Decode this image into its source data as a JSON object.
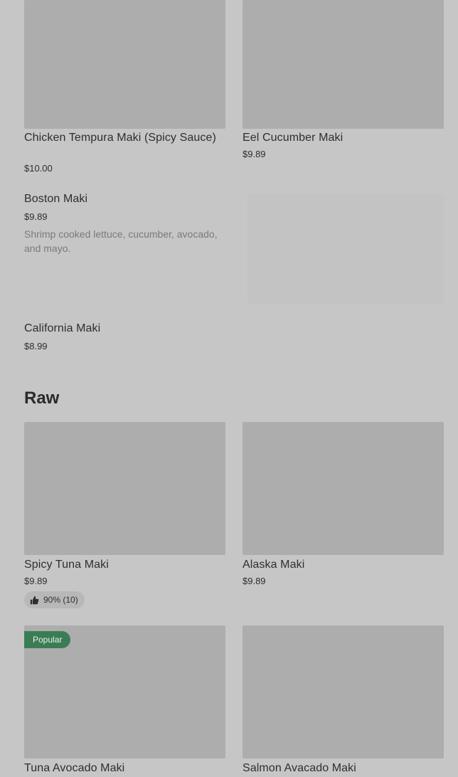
{
  "items": {
    "chicken_tempura": {
      "name": "Chicken Tempura Maki (Spicy Sauce)",
      "price": "$10.00"
    },
    "eel_cucumber": {
      "name": "Eel Cucumber Maki",
      "price": "$9.89"
    },
    "boston": {
      "name": "Boston Maki",
      "price": "$9.89",
      "description": "Shrimp cooked lettuce, cucumber, avocado, and mayo."
    },
    "california": {
      "name": "California Maki",
      "price": "$8.99"
    }
  },
  "raw_section": {
    "title": "Raw",
    "items": {
      "spicy_tuna": {
        "name": "Spicy Tuna Maki",
        "price": "$9.89",
        "rating": "90% (10)"
      },
      "alaska": {
        "name": "Alaska Maki",
        "price": "$9.89"
      },
      "tuna_avocado": {
        "name": "Tuna Avocado Maki",
        "badge": "Popular"
      },
      "salmon_avocado": {
        "name": "Salmon Avacado Maki"
      }
    }
  },
  "icons": {
    "rating": "thumbs-up-icon"
  },
  "colors": {
    "popular_badge": "#3a7d55",
    "background": "#c6c6c6",
    "image_placeholder": "#adadad"
  }
}
